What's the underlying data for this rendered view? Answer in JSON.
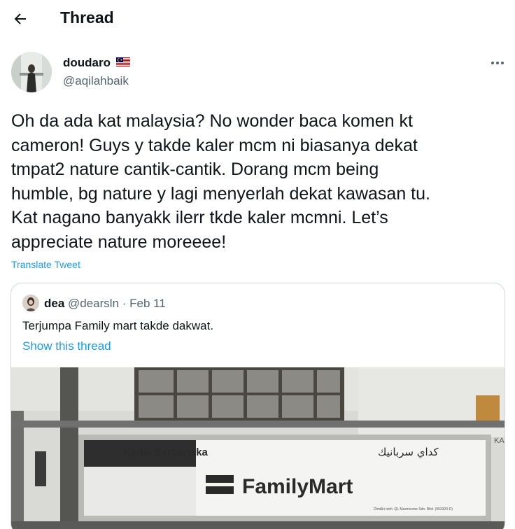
{
  "header": {
    "title": "Thread",
    "back_icon": "arrow-left-icon"
  },
  "author": {
    "display_name": "doudaro",
    "flag_icon": "malaysia-flag-icon",
    "handle": "@aqilahbaik"
  },
  "tweet": {
    "lines": [
      "Oh da ada kat malaysia? No wonder baca komen kt",
      "cameron! Guys y  takde kaler mcm ni biasanya dekat",
      "tmpat2 nature cantik-cantik. Dorang mcm being",
      "humble, bg nature y lagi menyerlah dekat kawasan tu.",
      "Kat nagano banyakk ilerr tkde kaler mcmni. Let’s",
      "appreciate nature moreeee!"
    ],
    "translate_label": "Translate Tweet"
  },
  "quote": {
    "name": "dea",
    "meta": "@dearsln · Feb 11",
    "text": "Terjumpa Family mart takde dakwat.",
    "show_thread": "Show this thread",
    "image": {
      "sign_left": "Kedai Serbaneka",
      "sign_arabic": "كداي سربانيك",
      "brand": "FamilyMart",
      "fine_print": "Dimiliki oleh: QL Maxincome Sdn. Bhd. (953320-D)",
      "edge_text": "KA"
    }
  },
  "colors": {
    "accent": "#1d9bf0",
    "secondary_text": "#536471",
    "border": "#cfd9de"
  }
}
